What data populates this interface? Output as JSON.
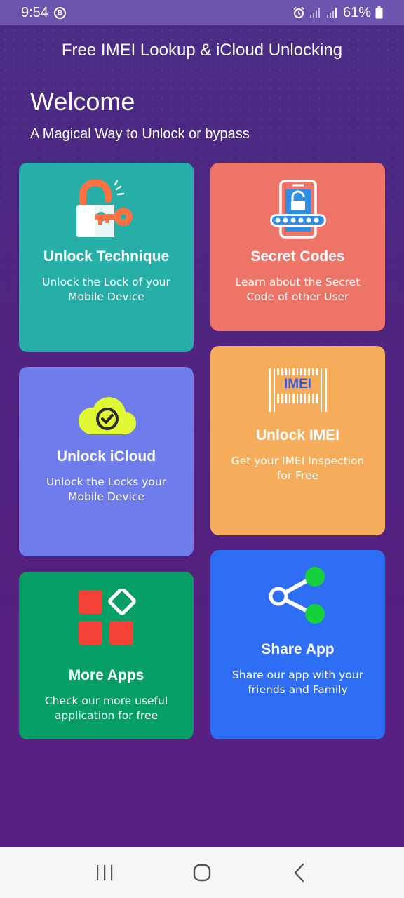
{
  "status_bar": {
    "time": "9:54",
    "badge": "B",
    "battery": "61%"
  },
  "header": {
    "app_title": "Free IMEI Lookup & iCloud Unlocking",
    "welcome": "Welcome",
    "tagline": "A Magical Way to Unlock or bypass"
  },
  "cards": {
    "unlock_technique": {
      "title": "Unlock Technique",
      "description": "Unlock the Lock of your\nMobile Device",
      "color": "#26afa7",
      "icon": "padlock-key-icon"
    },
    "secret_codes": {
      "title": "Secret Codes",
      "description": "Learn about the Secret\nCode of other User",
      "color": "#ee7468",
      "icon": "phone-lock-code-icon"
    },
    "unlock_icloud": {
      "title": "Unlock iCloud",
      "description": "Unlock the Locks your\nMobile Device",
      "color": "#6f7cec",
      "icon": "cloud-check-icon"
    },
    "unlock_imei": {
      "title": "Unlock IMEI",
      "description": "Get your IMEI Inspection\nfor Free",
      "color": "#f5ad5b",
      "icon": "imei-barcode-icon",
      "icon_text": "IMEI"
    },
    "more_apps": {
      "title": "More Apps",
      "description": "Check our more useful\napplication for free",
      "color": "#06a066",
      "icon": "apps-grid-icon"
    },
    "share_app": {
      "title": "Share App",
      "description": "Share our app with your\nfriends and Family",
      "color": "#2d6ef5",
      "icon": "share-icon"
    }
  },
  "nav_bar": {
    "recents": "recents-icon",
    "home": "home-icon",
    "back": "back-icon"
  }
}
